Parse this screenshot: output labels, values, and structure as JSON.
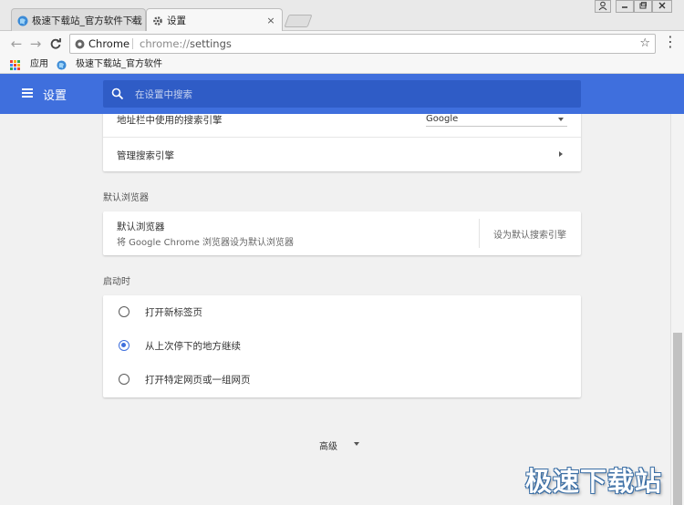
{
  "window": {
    "tabs": [
      {
        "title": "极速下载站_官方软件下载",
        "close": "×"
      },
      {
        "title": "设置",
        "close": "×"
      }
    ]
  },
  "toolbar": {
    "back": "←",
    "forward": "→",
    "reload": "C",
    "omnibox": {
      "chrome_label": "Chrome",
      "url_scheme": "chrome://",
      "url_path": "settings",
      "star": "☆"
    },
    "menu": "⋮"
  },
  "bookmarks": [
    {
      "label": "应用"
    },
    {
      "label": "极速下载站_官方软件"
    }
  ],
  "header": {
    "title": "设置",
    "search_placeholder": "在设置中搜索",
    "color": "#3f6fdd"
  },
  "search_engine": {
    "address_bar_label": "地址栏中使用的搜索引擎",
    "selected_engine": "Google",
    "manage_label": "管理搜索引擎"
  },
  "default_browser": {
    "section_title": "默认浏览器",
    "title": "默认浏览器",
    "subtitle": "将 Google Chrome 浏览器设为默认浏览器",
    "action": "设为默认搜索引擎"
  },
  "on_startup": {
    "section_title": "启动时",
    "options": [
      {
        "label": "打开新标签页",
        "checked": false
      },
      {
        "label": "从上次停下的地方继续",
        "checked": true
      },
      {
        "label": "打开特定网页或一组网页",
        "checked": false
      }
    ]
  },
  "advanced_label": "高级",
  "watermark": "极速下载站"
}
